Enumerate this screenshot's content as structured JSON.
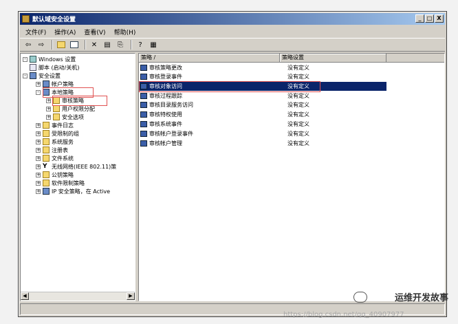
{
  "window": {
    "title": "默认域安全设置",
    "buttons": {
      "minimize": "_",
      "maximize": "□",
      "close": "X"
    }
  },
  "menu": [
    "文件(F)",
    "操作(A)",
    "查看(V)",
    "帮助(H)"
  ],
  "toolbar": {
    "icons": [
      "back-icon",
      "forward-icon",
      "up-icon",
      "show-tree-icon",
      "delete-icon",
      "properties-icon",
      "export-icon",
      "help-icon",
      "view-icon"
    ]
  },
  "tree": [
    {
      "label": "Windows 设置",
      "icon": "computer"
    },
    {
      "label": "脚本 (启动/关机)",
      "icon": "doc"
    },
    {
      "label": "安全设置",
      "icon": "shield"
    },
    {
      "label": "帐户策略",
      "icon": "shield"
    },
    {
      "label": "本地策略",
      "icon": "shield"
    },
    {
      "label": "审核策略",
      "icon": "folder"
    },
    {
      "label": "用户权限分配",
      "icon": "folder"
    },
    {
      "label": "安全选项",
      "icon": "folder"
    },
    {
      "label": "事件日志",
      "icon": "folder"
    },
    {
      "label": "受限制的组",
      "icon": "folder"
    },
    {
      "label": "系统服务",
      "icon": "folder"
    },
    {
      "label": "注册表",
      "icon": "folder"
    },
    {
      "label": "文件系统",
      "icon": "folder"
    },
    {
      "label": "无线网络(IEEE 802.11)策",
      "icon": "computer"
    },
    {
      "label": "公钥策略",
      "icon": "folder"
    },
    {
      "label": "软件限制策略",
      "icon": "folder"
    },
    {
      "label": "IP 安全策略，在 Active",
      "icon": "shield"
    }
  ],
  "list": {
    "headers": [
      "策略 /",
      "策略设置"
    ],
    "rows": [
      {
        "name": "审核策略更改",
        "setting": "没有定义"
      },
      {
        "name": "审核登录事件",
        "setting": "没有定义"
      },
      {
        "name": "审核对象访问",
        "setting": "没有定义"
      },
      {
        "name": "审核过程跟踪",
        "setting": "没有定义"
      },
      {
        "name": "审核目录服务访问",
        "setting": "没有定义"
      },
      {
        "name": "审核特权使用",
        "setting": "没有定义"
      },
      {
        "name": "审核系统事件",
        "setting": "没有定义"
      },
      {
        "name": "审核帐户登录事件",
        "setting": "没有定义"
      },
      {
        "name": "审核帐户管理",
        "setting": "没有定义"
      }
    ]
  },
  "watermark": "运维开发故事",
  "csdn_url": "https://blog.csdn.net/qq_40907977",
  "colors": {
    "title_start": "#0a246a",
    "selection": "#0a246a",
    "highlight_box": "#e05050"
  }
}
